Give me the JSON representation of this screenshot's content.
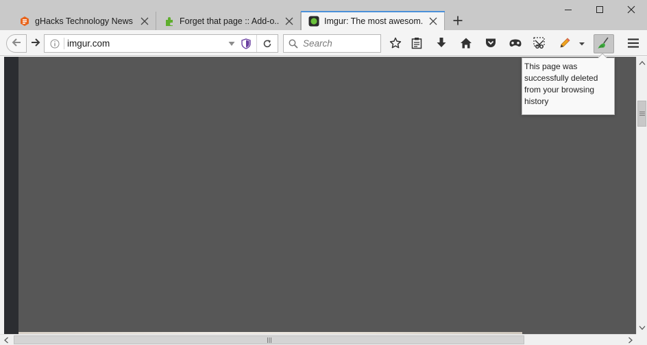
{
  "tabs": [
    {
      "title": "gHacks Technology News",
      "favicon": "ghacks-icon",
      "active": false
    },
    {
      "title": "Forget that page :: Add-o...",
      "favicon": "addon-puzzle-icon",
      "active": false
    },
    {
      "title": "Imgur: The most awesom...",
      "favicon": "imgur-icon",
      "active": true
    }
  ],
  "address_bar": {
    "url": "imgur.com"
  },
  "search_bar": {
    "placeholder": "Search"
  },
  "notification": {
    "message": "This page was successfully deleted from your browsing history"
  },
  "colors": {
    "accent": "#4a90d9",
    "content_bg": "#575757",
    "broom_green": "#3daa3d",
    "shield_purple": "#6a3fa0"
  }
}
